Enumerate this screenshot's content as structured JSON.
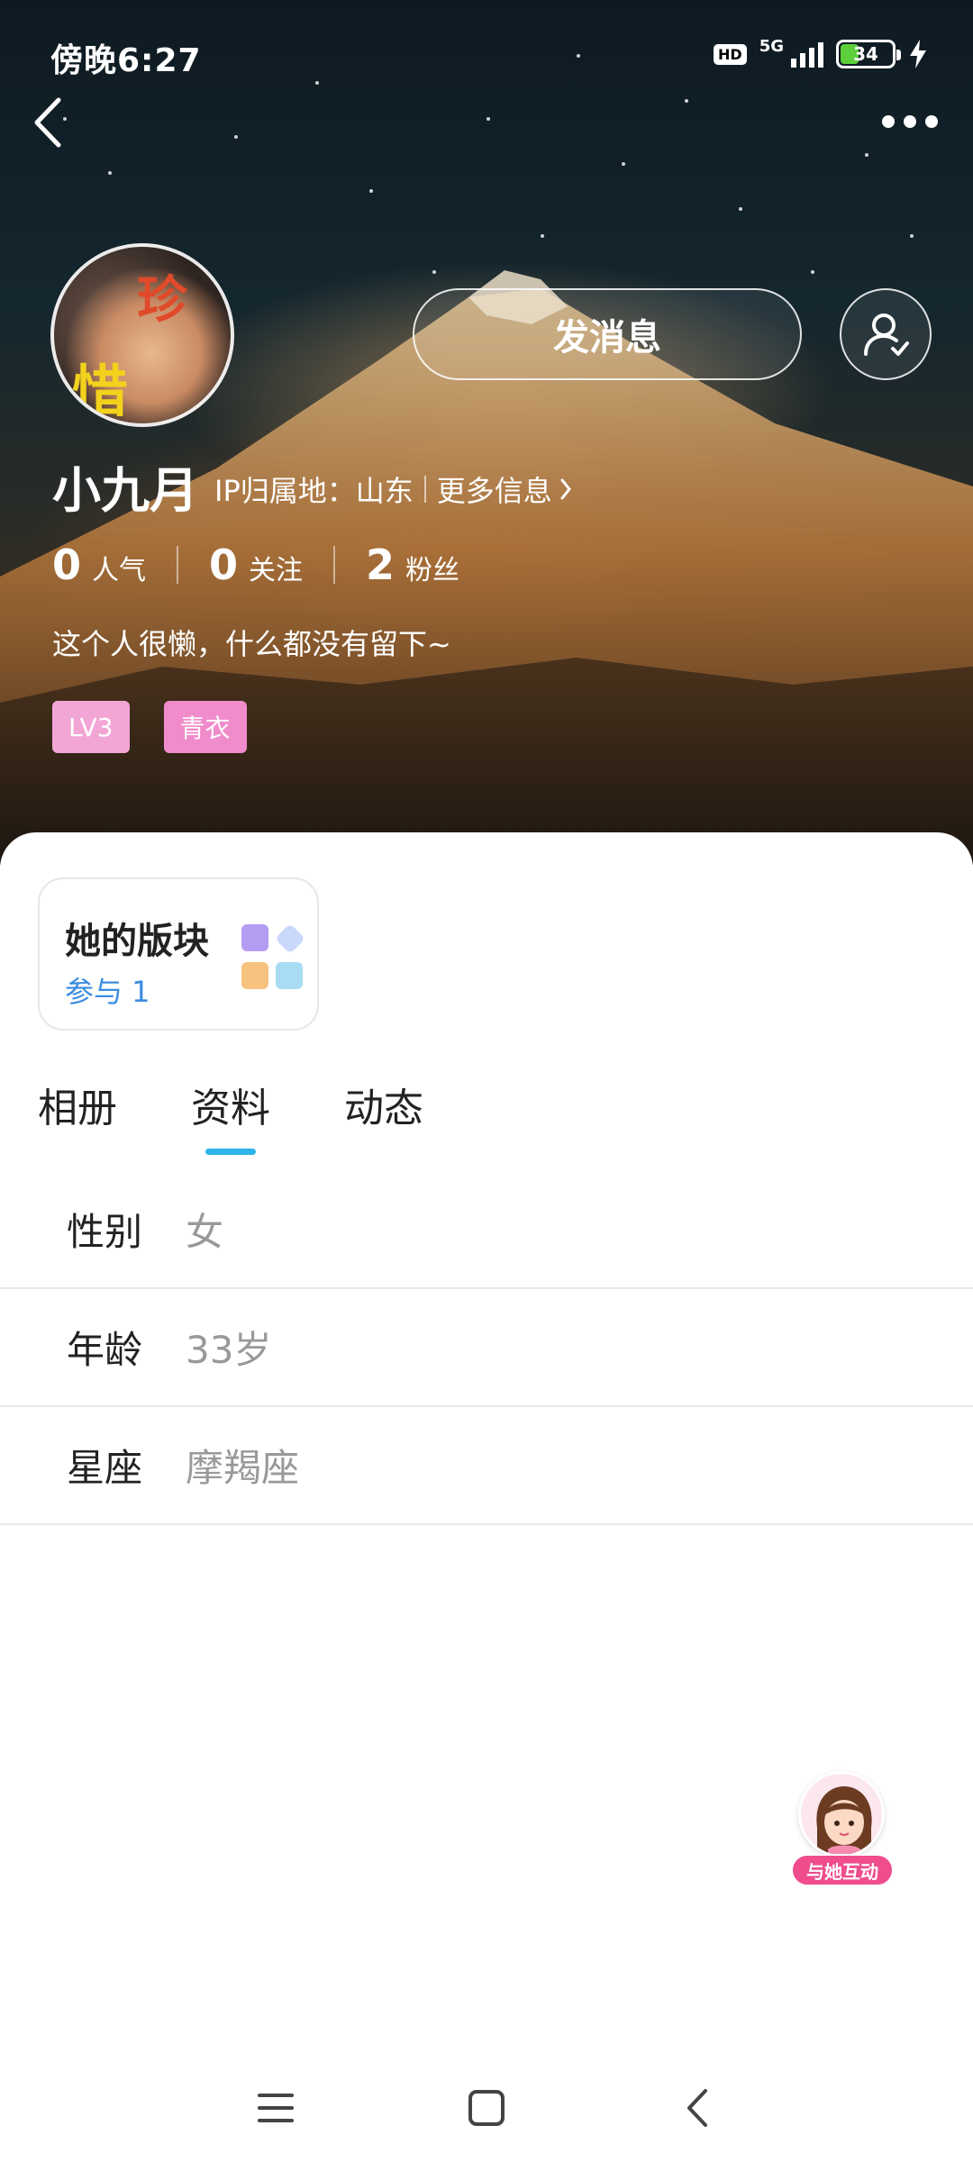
{
  "status_bar": {
    "time": "傍晚6:27",
    "hd_label": "HD",
    "network": "5G",
    "battery": "34"
  },
  "profile": {
    "avatar_text_1": "珍",
    "avatar_text_2": "惜",
    "send_message_label": "发消息",
    "username": "小九月",
    "ip_location": "IP归属地：山东",
    "more_info_label": "更多信息",
    "stats": [
      {
        "value": "0",
        "label": "人气"
      },
      {
        "value": "0",
        "label": "关注"
      },
      {
        "value": "2",
        "label": "粉丝"
      }
    ],
    "bio": "这个人很懒，什么都没有留下~",
    "badges": [
      {
        "label": "LV3",
        "color": "#f2a6d6"
      },
      {
        "label": "青衣",
        "color": "#f08ccb"
      }
    ]
  },
  "forum_card": {
    "title": "她的版块",
    "subtitle": "参与 1"
  },
  "tabs": [
    {
      "label": "相册",
      "active": false
    },
    {
      "label": "资料",
      "active": true
    },
    {
      "label": "动态",
      "active": false
    }
  ],
  "info": [
    {
      "label": "性别",
      "value": "女"
    },
    {
      "label": "年龄",
      "value": "33岁"
    },
    {
      "label": "星座",
      "value": "摩羯座"
    }
  ],
  "fab": {
    "label": "与她互动"
  },
  "colors": {
    "accent": "#2bb5e8",
    "link": "#3b8be0",
    "fab_pink": "#ef4d8e"
  }
}
